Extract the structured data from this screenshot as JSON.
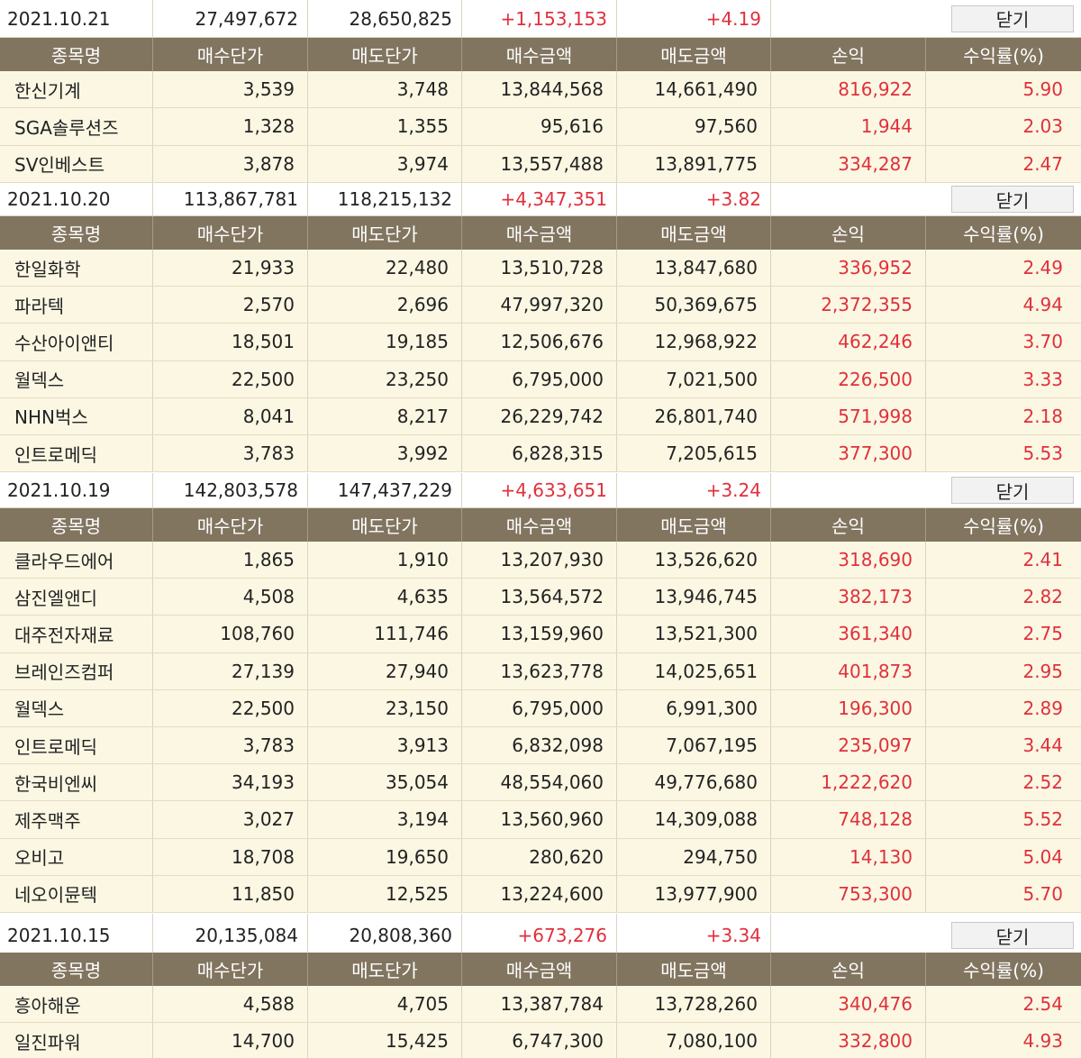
{
  "headers": [
    "종목명",
    "매수단가",
    "매도단가",
    "매수금액",
    "매도금액",
    "손익",
    "수익률(%)"
  ],
  "close_label": "닫기",
  "colors": {
    "header_bg": "#827560",
    "row_bg": "#fbf7e3",
    "profit": "#e0303c"
  },
  "days": [
    {
      "date": "2021.10.21",
      "buy_total": "27,497,672",
      "sell_total": "28,650,825",
      "profit": "+1,153,153",
      "rate": "+4.19",
      "rows": [
        [
          "한신기계",
          "3,539",
          "3,748",
          "13,844,568",
          "14,661,490",
          "816,922",
          "5.90"
        ],
        [
          "SGA솔루션즈",
          "1,328",
          "1,355",
          "95,616",
          "97,560",
          "1,944",
          "2.03"
        ],
        [
          "SV인베스트",
          "3,878",
          "3,974",
          "13,557,488",
          "13,891,775",
          "334,287",
          "2.47"
        ]
      ]
    },
    {
      "date": "2021.10.20",
      "buy_total": "113,867,781",
      "sell_total": "118,215,132",
      "profit": "+4,347,351",
      "rate": "+3.82",
      "rows": [
        [
          "한일화학",
          "21,933",
          "22,480",
          "13,510,728",
          "13,847,680",
          "336,952",
          "2.49"
        ],
        [
          "파라텍",
          "2,570",
          "2,696",
          "47,997,320",
          "50,369,675",
          "2,372,355",
          "4.94"
        ],
        [
          "수산아이앤티",
          "18,501",
          "19,185",
          "12,506,676",
          "12,968,922",
          "462,246",
          "3.70"
        ],
        [
          "월덱스",
          "22,500",
          "23,250",
          "6,795,000",
          "7,021,500",
          "226,500",
          "3.33"
        ],
        [
          "NHN벅스",
          "8,041",
          "8,217",
          "26,229,742",
          "26,801,740",
          "571,998",
          "2.18"
        ],
        [
          "인트로메딕",
          "3,783",
          "3,992",
          "6,828,315",
          "7,205,615",
          "377,300",
          "5.53"
        ]
      ]
    },
    {
      "date": "2021.10.19",
      "buy_total": "142,803,578",
      "sell_total": "147,437,229",
      "profit": "+4,633,651",
      "rate": "+3.24",
      "rows": [
        [
          "클라우드에어",
          "1,865",
          "1,910",
          "13,207,930",
          "13,526,620",
          "318,690",
          "2.41"
        ],
        [
          "삼진엘앤디",
          "4,508",
          "4,635",
          "13,564,572",
          "13,946,745",
          "382,173",
          "2.82"
        ],
        [
          "대주전자재료",
          "108,760",
          "111,746",
          "13,159,960",
          "13,521,300",
          "361,340",
          "2.75"
        ],
        [
          "브레인즈컴퍼",
          "27,139",
          "27,940",
          "13,623,778",
          "14,025,651",
          "401,873",
          "2.95"
        ],
        [
          "월덱스",
          "22,500",
          "23,150",
          "6,795,000",
          "6,991,300",
          "196,300",
          "2.89"
        ],
        [
          "인트로메딕",
          "3,783",
          "3,913",
          "6,832,098",
          "7,067,195",
          "235,097",
          "3.44"
        ],
        [
          "한국비엔씨",
          "34,193",
          "35,054",
          "48,554,060",
          "49,776,680",
          "1,222,620",
          "2.52"
        ],
        [
          "제주맥주",
          "3,027",
          "3,194",
          "13,560,960",
          "14,309,088",
          "748,128",
          "5.52"
        ],
        [
          "오비고",
          "18,708",
          "19,650",
          "280,620",
          "294,750",
          "14,130",
          "5.04"
        ],
        [
          "네오이뮨텍",
          "11,850",
          "12,525",
          "13,224,600",
          "13,977,900",
          "753,300",
          "5.70"
        ]
      ]
    },
    {
      "date": "2021.10.15",
      "buy_total": "20,135,084",
      "sell_total": "20,808,360",
      "profit": "+673,276",
      "rate": "+3.34",
      "rows": [
        [
          "흥아해운",
          "4,588",
          "4,705",
          "13,387,784",
          "13,728,260",
          "340,476",
          "2.54"
        ],
        [
          "일진파워",
          "14,700",
          "15,425",
          "6,747,300",
          "7,080,100",
          "332,800",
          "4.93"
        ]
      ]
    }
  ]
}
